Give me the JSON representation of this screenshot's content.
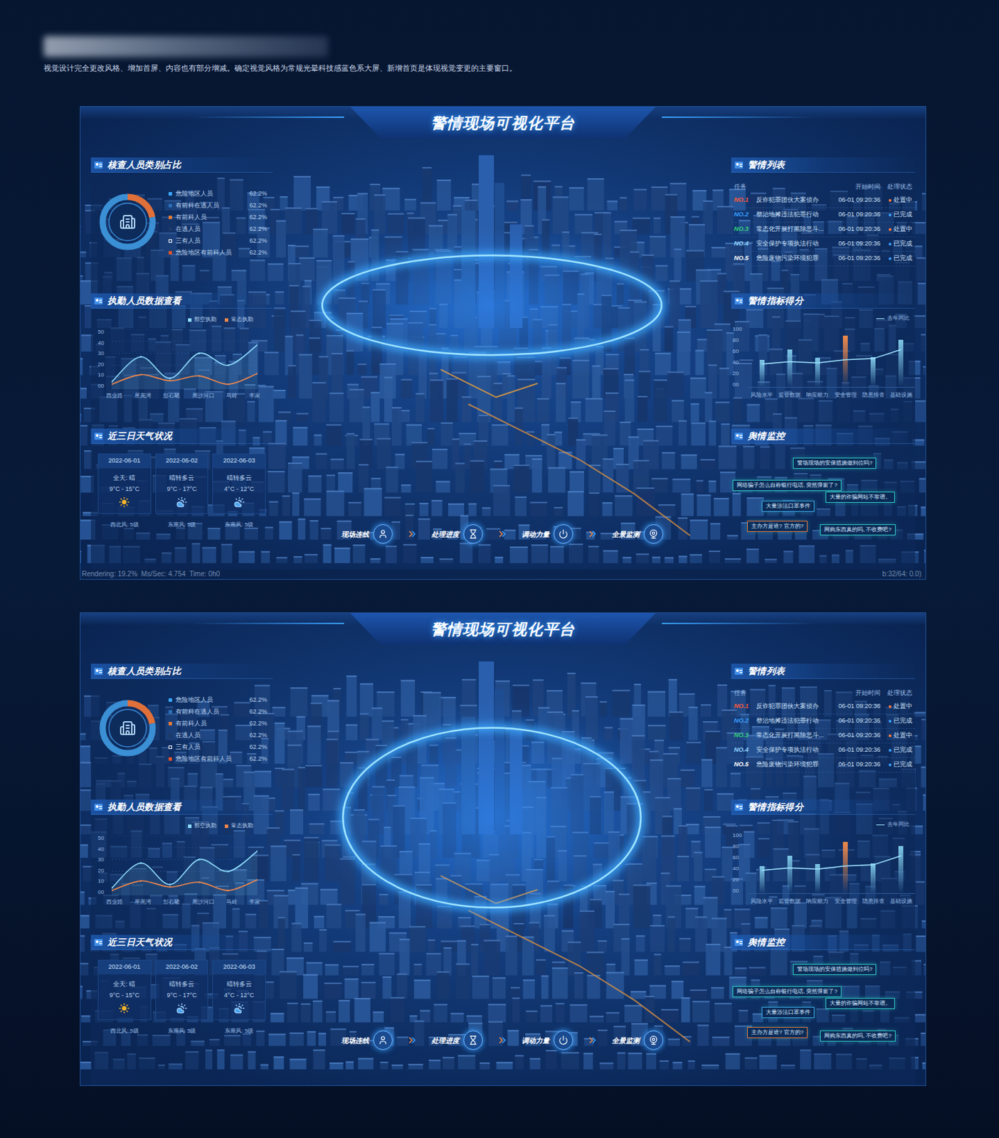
{
  "page": {
    "subtitle": "视觉设计完全更改风格、增加首屏、内容也有部分增减。确定视觉风格为常规光晕科技感蓝色系大屏、新增首页是体现视觉变更的主要窗口。"
  },
  "dashboards": [
    {
      "title": "警情现场可视化平台",
      "personnel": {
        "title": "核查人员类别占比",
        "donut": [
          {
            "share": 0.22,
            "color": "#e0703a"
          },
          {
            "share": 0.78,
            "color": "#3b8fd4"
          }
        ],
        "legend": [
          {
            "label": "危险地区人员",
            "value": "62.2%",
            "color": "#3aa6ff"
          },
          {
            "label": "有前科在逃人员",
            "value": "62.2%",
            "color": "#2b6fb8"
          },
          {
            "label": "有前科人员",
            "value": "62.2%",
            "color": "#e07b39"
          },
          {
            "label": "在逃人员",
            "value": "62.2%",
            "color": "#1d3a66"
          },
          {
            "label": "三有人员",
            "value": "62.2%",
            "color": "#ffffff"
          },
          {
            "label": "危险地区有前科人员",
            "value": "62.2%",
            "color": "#d9542b"
          }
        ]
      },
      "duty": {
        "title": "执勤人员数据查看",
        "y_ticks": [
          "50",
          "40",
          "30",
          "20",
          "10",
          "00"
        ],
        "x_labels": [
          "西业路",
          "星亮湾",
          "彭石畿",
          "周沙河口",
          "马岭",
          "李家"
        ],
        "series": [
          {
            "label": "部空执勤",
            "color": "#8fdcff",
            "values": [
              6,
              27,
              9,
              30,
              20,
              37
            ]
          },
          {
            "label": "常态执勤",
            "color": "#f0874a",
            "values": [
              4,
              12,
              7,
              11,
              4,
              13
            ]
          }
        ]
      },
      "weather": {
        "title": "近三日天气状况",
        "days": [
          {
            "date": "2022-06-01",
            "desc": "全天: 晴",
            "temp": "9°C - 15°C",
            "kind": "sunny",
            "wind": "西北风: 5级"
          },
          {
            "date": "2022-06-02",
            "desc": "晴转多云",
            "temp": "9°C - 17°C",
            "kind": "partly-cloudy",
            "wind": "东南风: 5级"
          },
          {
            "date": "2022-06-03",
            "desc": "晴转多云",
            "temp": "4°C - 12°C",
            "kind": "partly-cloudy",
            "wind": "东南风: 5级"
          }
        ]
      },
      "alerts": {
        "title": "警情列表",
        "columns": [
          "任务",
          "开始时间",
          "处理状态"
        ],
        "rows": [
          {
            "no": "NO.1",
            "task": "反诈犯罪团伙大案侦办",
            "time": "06-01 09:20:36",
            "status": "处置中",
            "color": "#ff5a3c",
            "status_color": "#ff7a3d"
          },
          {
            "no": "NO.2",
            "task": "整治地摊违法犯罪行动",
            "time": "06-01 09:20:36",
            "status": "已完成",
            "color": "#3aa0ff",
            "status_color": "#3aa0ff"
          },
          {
            "no": "NO.3",
            "task": "常态化开展打黑除恶斗...",
            "time": "06-01 09:20:36",
            "status": "处置中",
            "color": "#33d17a",
            "status_color": "#ff7a3d"
          },
          {
            "no": "NO.4",
            "task": "安全保护专项执法行动",
            "time": "06-01 09:20:36",
            "status": "已完成",
            "color": "#8fd3ff",
            "status_color": "#3aa0ff"
          },
          {
            "no": "NO.5",
            "task": "危险废物污染环境犯罪",
            "time": "06-01 09:20:36",
            "status": "已完成",
            "color": "#ffffff",
            "status_color": "#3aa0ff"
          }
        ]
      },
      "scores": {
        "title": "警情指标得分",
        "legend": "去年同比",
        "y_ticks": [
          "100",
          "80",
          "60",
          "40",
          "20",
          "00"
        ],
        "x_labels": [
          "风险水平",
          "监管数据",
          "响应能力",
          "安全管理",
          "隐患排查",
          "基础设施"
        ],
        "bars": [
          {
            "value": 45,
            "color": "#7fc8e8"
          },
          {
            "value": 62,
            "color": "#7fc8e8"
          },
          {
            "value": 48,
            "color": "#7fc8e8"
          },
          {
            "value": 85,
            "color": "#f08a4b"
          },
          {
            "value": 50,
            "color": "#7fc8e8"
          },
          {
            "value": 78,
            "color": "#7fc8e8"
          }
        ],
        "line": [
          38,
          42,
          40,
          45,
          47,
          62
        ]
      },
      "opinion": {
        "title": "舆情监控",
        "messages": [
          {
            "text": "警场现场的安保措施做到位吗?",
            "color": "#2fc4c0"
          },
          {
            "text": "网络骗子怎么自称银行电话, 突然弹窗了?",
            "color": "#2fc4c0"
          },
          {
            "text": "大量的诈骗网站不靠谱。",
            "color": "#2fc4c0"
          },
          {
            "text": "大量涉法口罩事件",
            "color": "#3aa0e0"
          },
          {
            "text": "主办方是谁? 官方的?",
            "color": "#e0743a"
          },
          {
            "text": "网购东西真的吗, 不收费吧?",
            "color": "#2fc4c0"
          }
        ]
      },
      "actions": [
        {
          "label": "现场连线",
          "kind": "user"
        },
        {
          "label": "处理进度",
          "kind": "hourglass"
        },
        {
          "label": "调动力量",
          "kind": "power"
        },
        {
          "label": "全景监测",
          "kind": "camera"
        }
      ],
      "status_bar": {
        "left": "Rendering: 19.2%  Ms/Sec: 4.754  Time: 0h0",
        "right": "b:32/64: 0.0)"
      }
    },
    {
      "title": "警情现场可视化平台",
      "personnel": {
        "title": "核查人员类别占比",
        "donut": [
          {
            "share": 0.22,
            "color": "#e0703a"
          },
          {
            "share": 0.78,
            "color": "#3b8fd4"
          }
        ],
        "legend": [
          {
            "label": "危险地区人员",
            "value": "62.2%",
            "color": "#3aa6ff"
          },
          {
            "label": "有前科在逃人员",
            "value": "62.2%",
            "color": "#2b6fb8"
          },
          {
            "label": "有前科人员",
            "value": "62.2%",
            "color": "#e07b39"
          },
          {
            "label": "在逃人员",
            "value": "62.2%",
            "color": "#1d3a66"
          },
          {
            "label": "三有人员",
            "value": "62.2%",
            "color": "#ffffff"
          },
          {
            "label": "危险地区有前科人员",
            "value": "62.2%",
            "color": "#d9542b"
          }
        ]
      },
      "duty": {
        "title": "执勤人员数据查看",
        "y_ticks": [
          "50",
          "40",
          "30",
          "20",
          "10",
          "00"
        ],
        "x_labels": [
          "西业路",
          "星亮湾",
          "彭石畿",
          "周沙河口",
          "马岭",
          "李家"
        ],
        "series": [
          {
            "label": "部空执勤",
            "color": "#8fdcff",
            "values": [
              6,
              27,
              9,
              30,
              20,
              37
            ]
          },
          {
            "label": "常态执勤",
            "color": "#f0874a",
            "values": [
              4,
              12,
              7,
              11,
              4,
              13
            ]
          }
        ]
      },
      "weather": {
        "title": "近三日天气状况",
        "days": [
          {
            "date": "2022-06-01",
            "desc": "全天: 晴",
            "temp": "9°C - 15°C",
            "kind": "sunny",
            "wind": "西北风: 5级"
          },
          {
            "date": "2022-06-02",
            "desc": "晴转多云",
            "temp": "9°C - 17°C",
            "kind": "partly-cloudy",
            "wind": "东南风: 5级"
          },
          {
            "date": "2022-06-03",
            "desc": "晴转多云",
            "temp": "4°C - 12°C",
            "kind": "partly-cloudy",
            "wind": "东南风: 5级"
          }
        ]
      },
      "alerts": {
        "title": "警情列表",
        "columns": [
          "任务",
          "开始时间",
          "处理状态"
        ],
        "rows": [
          {
            "no": "NO.1",
            "task": "反诈犯罪团伙大案侦办",
            "time": "06-01 09:20:36",
            "status": "处置中",
            "color": "#ff5a3c",
            "status_color": "#ff7a3d"
          },
          {
            "no": "NO.2",
            "task": "整治地摊违法犯罪行动",
            "time": "06-01 09:20:36",
            "status": "已完成",
            "color": "#3aa0ff",
            "status_color": "#3aa0ff"
          },
          {
            "no": "NO.3",
            "task": "常态化开展打黑除恶斗...",
            "time": "06-01 09:20:36",
            "status": "处置中",
            "color": "#33d17a",
            "status_color": "#ff7a3d"
          },
          {
            "no": "NO.4",
            "task": "安全保护专项执法行动",
            "time": "06-01 09:20:36",
            "status": "已完成",
            "color": "#8fd3ff",
            "status_color": "#3aa0ff"
          },
          {
            "no": "NO.5",
            "task": "危险废物污染环境犯罪",
            "time": "06-01 09:20:36",
            "status": "已完成",
            "color": "#ffffff",
            "status_color": "#3aa0ff"
          }
        ]
      },
      "scores": {
        "title": "警情指标得分",
        "legend": "去年同比",
        "y_ticks": [
          "100",
          "80",
          "60",
          "40",
          "20",
          "00"
        ],
        "x_labels": [
          "风险水平",
          "监管数据",
          "响应能力",
          "安全管理",
          "隐患排查",
          "基础设施"
        ],
        "bars": [
          {
            "value": 45,
            "color": "#7fc8e8"
          },
          {
            "value": 62,
            "color": "#7fc8e8"
          },
          {
            "value": 48,
            "color": "#7fc8e8"
          },
          {
            "value": 85,
            "color": "#f08a4b"
          },
          {
            "value": 50,
            "color": "#7fc8e8"
          },
          {
            "value": 78,
            "color": "#7fc8e8"
          }
        ],
        "line": [
          38,
          42,
          40,
          45,
          47,
          62
        ]
      },
      "opinion": {
        "title": "舆情监控",
        "messages": [
          {
            "text": "警场现场的安保措施做到位吗?",
            "color": "#2fc4c0"
          },
          {
            "text": "网络骗子怎么自称银行电话, 突然弹窗了?",
            "color": "#2fc4c0"
          },
          {
            "text": "大量的诈骗网站不靠谱。",
            "color": "#2fc4c0"
          },
          {
            "text": "大量涉法口罩事件",
            "color": "#3aa0e0"
          },
          {
            "text": "主办方是谁? 官方的?",
            "color": "#e0743a"
          },
          {
            "text": "网购东西真的吗, 不收费吧?",
            "color": "#2fc4c0"
          }
        ]
      },
      "actions": [
        {
          "label": "现场连线",
          "kind": "user"
        },
        {
          "label": "处理进度",
          "kind": "hourglass"
        },
        {
          "label": "调动力量",
          "kind": "power"
        },
        {
          "label": "全景监测",
          "kind": "camera"
        }
      ],
      "status_bar": null
    }
  ]
}
